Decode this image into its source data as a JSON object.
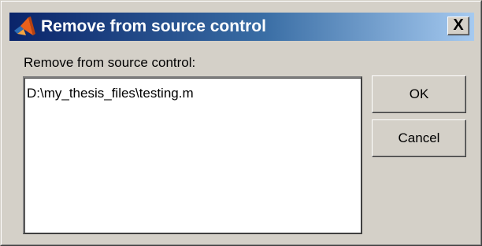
{
  "window": {
    "title": "Remove from source control",
    "close_label": "X",
    "title_icon": "matlab-logo-icon"
  },
  "dialog": {
    "prompt": "Remove from source control:",
    "files": [
      "D:\\my_thesis_files\\testing.m"
    ]
  },
  "buttons": {
    "ok_label": "OK",
    "cancel_label": "Cancel"
  },
  "colors": {
    "titlebar_start": "#0a246a",
    "titlebar_end": "#a6caf0",
    "face": "#d4d0c8"
  }
}
